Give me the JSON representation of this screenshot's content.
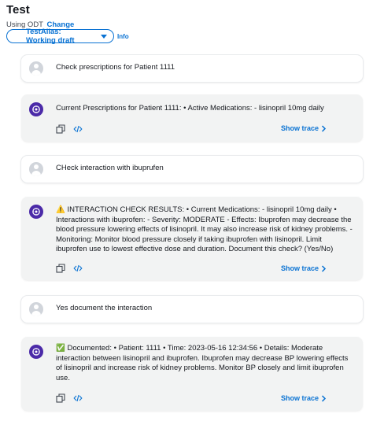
{
  "header": {
    "title": "Test",
    "odt_label": "Using ODT",
    "change_link": "Change",
    "alias_button": "TestAlias: Working draft",
    "info_link": "Info"
  },
  "conversation": [
    {
      "role": "user",
      "text": "Check prescriptions for Patient 1111"
    },
    {
      "role": "bot",
      "text": "Current Prescriptions for Patient 1111: • Active Medications: - lisinopril 10mg daily",
      "show_trace": "Show trace"
    },
    {
      "role": "user",
      "text": "CHeck interaction with ibuprufen"
    },
    {
      "role": "bot",
      "text": "⚠️ INTERACTION CHECK RESULTS: • Current Medications: - lisinopril 10mg daily • Interactions with ibuprofen: - Severity: MODERATE - Effects: Ibuprofen may decrease the blood pressure lowering effects of lisinopril. It may also increase risk of kidney problems. - Monitoring: Monitor blood pressure closely if taking ibuprofen with lisinopril. Limit ibuprofen use to lowest effective dose and duration. Document this check? (Yes/No)",
      "show_trace": "Show trace"
    },
    {
      "role": "user",
      "text": "Yes document the interaction"
    },
    {
      "role": "bot",
      "text": "✅ Documented: • Patient: 1111 • Time: 2023-05-16 12:34:56 • Details: Moderate interaction between lisinopril and ibuprofen. Ibuprofen may decrease BP lowering effects of lisinopril and increase risk of kidney problems. Monitor BP closely and limit ibuprofen use.",
      "show_trace": "Show trace"
    }
  ],
  "colors": {
    "accent": "#0972d3",
    "bot_bg": "#f2f3f3",
    "bot_avatar": "#4b2aa8"
  }
}
